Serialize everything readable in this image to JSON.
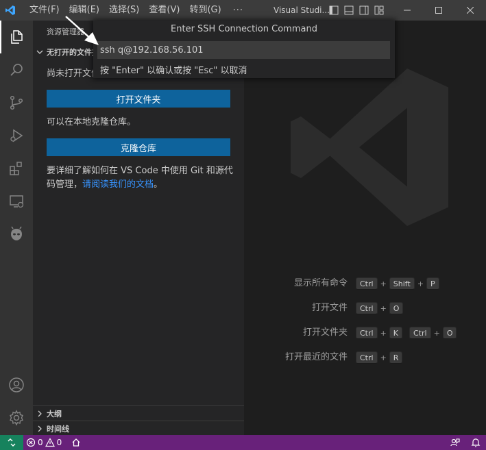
{
  "titlebar": {
    "menu": [
      "文件(F)",
      "编辑(E)",
      "选择(S)",
      "查看(V)",
      "转到(G)"
    ],
    "more": "···",
    "window_title": "Visual Studi..."
  },
  "sidebar": {
    "title": "资源管理器",
    "section_no_folder": "无打开的文件夹",
    "no_folder_text": "尚未打开文件夹。",
    "open_folder_button": "打开文件夹",
    "clone_hint": "可以在本地克隆仓库。",
    "clone_button": "克隆仓库",
    "git_text_1": "要详细了解如何在 VS Code 中使用 Git 和源代",
    "git_text_2": "码管理，",
    "git_link": "请阅读我们的文档",
    "git_text_end": "。",
    "section_outline": "大纲",
    "section_timeline": "时间线"
  },
  "quick_input": {
    "title": "Enter SSH Connection Command",
    "value": "ssh q@192.168.56.101",
    "message": "按 \"Enter\" 以确认或按 \"Esc\" 以取消"
  },
  "shortcuts": [
    {
      "label": "显示所有命令",
      "keys": [
        [
          "Ctrl",
          "Shift",
          "P"
        ]
      ]
    },
    {
      "label": "打开文件",
      "keys": [
        [
          "Ctrl",
          "O"
        ]
      ]
    },
    {
      "label": "打开文件夹",
      "keys": [
        [
          "Ctrl",
          "K"
        ],
        [
          "Ctrl",
          "O"
        ]
      ]
    },
    {
      "label": "打开最近的文件",
      "keys": [
        [
          "Ctrl",
          "R"
        ]
      ]
    }
  ],
  "statusbar": {
    "errors": "0",
    "warnings": "0"
  },
  "colors": {
    "accent_status": "#68217a",
    "remote": "#16825d",
    "button": "#0e639c",
    "link": "#3794ff"
  }
}
